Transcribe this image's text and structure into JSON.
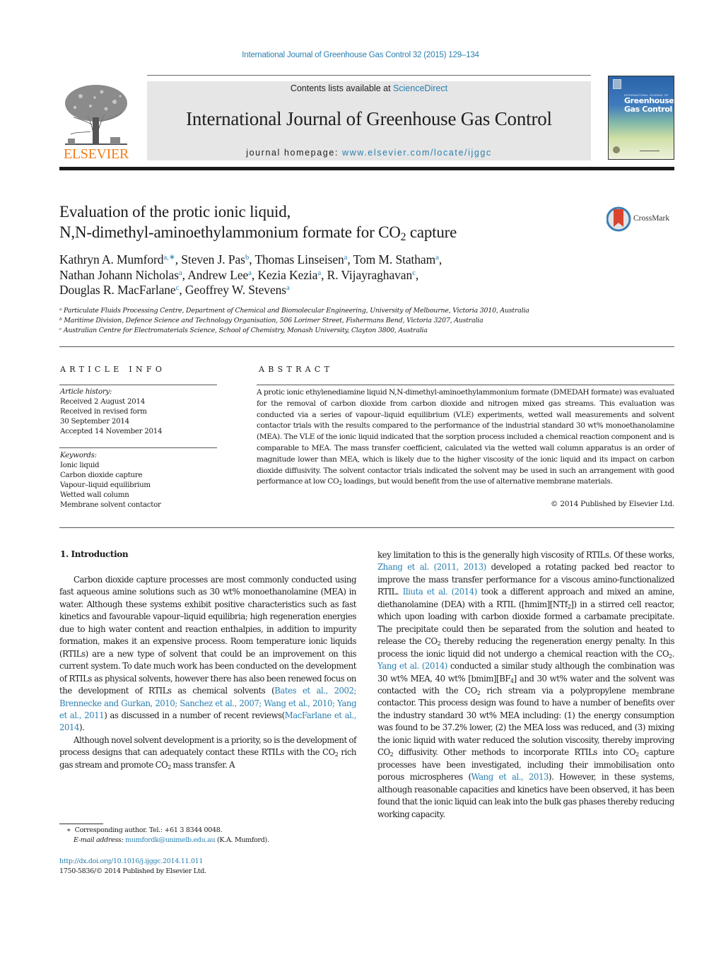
{
  "running_head": "International Journal of Greenhouse Gas Control 32 (2015) 129–134",
  "banner": {
    "contents_prefix": "Contents lists available at ",
    "contents_link": "ScienceDirect",
    "journal_title": "International Journal of Greenhouse Gas Control",
    "homepage_prefix": "journal homepage: ",
    "homepage_link": "www.elsevier.com/locate/ijggc"
  },
  "publisher_logo": {
    "wordmark": "ELSEVIER",
    "color": "#f07d1a"
  },
  "cover": {
    "supertitle": "INTERNATIONAL JOURNAL OF",
    "title_line1": "Greenhouse",
    "title_line2": "Gas Control"
  },
  "crossmark": {
    "label": "CrossMark"
  },
  "article": {
    "title_line1": "Evaluation of the protic ionic liquid,",
    "title_line2_pre": "N,N-dimethyl-aminoethylammonium formate for CO",
    "title_line2_sub": "2",
    "title_line2_post": " capture",
    "authors": [
      {
        "name": "Kathryn A. Mumford",
        "aff": "a,∗",
        "sep": ", "
      },
      {
        "name": "Steven J. Pas",
        "aff": "b",
        "sep": ", "
      },
      {
        "name": "Thomas Linseisen",
        "aff": "a",
        "sep": ", "
      },
      {
        "name": "Tom M. Statham",
        "aff": "a",
        "sep": ","
      },
      {
        "name": "Nathan Johann Nicholas",
        "aff": "a",
        "sep": ", "
      },
      {
        "name": "Andrew Lee",
        "aff": "a",
        "sep": ", "
      },
      {
        "name": "Kezia Kezia",
        "aff": "a",
        "sep": ", "
      },
      {
        "name": "R. Vijayraghavan",
        "aff": "c",
        "sep": ","
      },
      {
        "name": "Douglas R. MacFarlane",
        "aff": "c",
        "sep": ", "
      },
      {
        "name": "Geoffrey W. Stevens",
        "aff": "a",
        "sep": ""
      }
    ],
    "affiliations": [
      {
        "key": "a",
        "text": "Particulate Fluids Processing Centre, Department of Chemical and Biomolecular Engineering, University of Melbourne, Victoria 3010, Australia"
      },
      {
        "key": "b",
        "text": "Maritime Division, Defence Science and Technology Organisation, 506 Lorimer Street, Fishermans Bend, Victoria 3207, Australia"
      },
      {
        "key": "c",
        "text": "Australian Centre for Electromaterials Science, School of Chemistry, Monash University, Clayton 3800, Australia"
      }
    ]
  },
  "article_info": {
    "heading": "ARTICLE INFO",
    "history_label": "Article history:",
    "history": [
      "Received 2 August 2014",
      "Received in revised form",
      "30 September 2014",
      "Accepted 14 November 2014"
    ],
    "keywords_label": "Keywords:",
    "keywords": [
      "Ionic liquid",
      "Carbon dioxide capture",
      "Vapour–liquid equilibrium",
      "Wetted wall column",
      "Membrane solvent contactor"
    ]
  },
  "abstract": {
    "heading": "ABSTRACT",
    "text_main": "A protic ionic ethylenediamine liquid N,N-dimethyl-aminoethylammonium formate (DMEDAH formate) was evaluated for the removal of carbon dioxide from carbon dioxide and nitrogen mixed gas streams. This evaluation was conducted via a series of vapour–liquid equilibrium (VLE) experiments, wetted wall measurements and solvent contactor trials with the results compared to the performance of the industrial standard 30 wt% monoethanolamine (MEA). The VLE of the ionic liquid indicated that the sorption process included a chemical reaction component and is comparable to MEA. The mass transfer coefficient, calculated via the wetted wall column apparatus is an order of magnitude lower than MEA, which is likely due to the higher viscosity of the ionic liquid and its impact on carbon dioxide diffusivity. The solvent contactor trials indicated the solvent may be used in such an arrangement with good performance at low CO",
    "text_sub": "2",
    "text_end": " loadings, but would benefit from the use of alternative membrane materials.",
    "copyright": "© 2014 Published by Elsevier Ltd."
  },
  "introduction": {
    "heading": "1.  Introduction",
    "p1": [
      {
        "t": "Carbon dioxide capture processes are most commonly conducted using fast aqueous amine solutions such as 30 wt% monoethanolamine (MEA) in water. Although these systems exhibit positive characteristics such as fast kinetics and favourable vapour–liquid equilibria; high regeneration energies due to high water content and reaction enthalpies, in addition to impurity formation, makes it an expensive process. Room temperature ionic liquids (RTILs) are a new type of solvent that could be an improvement on this current system. To date much work has been conducted on the development of RTILs as physical solvents, however there has also been renewed focus on the development of RTILs as chemical solvents ("
      },
      {
        "link": "Bates et al., 2002; Brennecke and Gurkan, 2010; Sanchez et al., 2007; Wang et al., 2010; Yang et al., 2011"
      },
      {
        "t": ") as discussed in a number of recent reviews("
      },
      {
        "link": "MacFarlane et al., 2014"
      },
      {
        "t": ")."
      }
    ],
    "p2": [
      {
        "t": "Although novel solvent development is a priority, so is the development of process designs that can adequately contact these RTILs with the CO"
      },
      {
        "sub": "2"
      },
      {
        "t": " rich gas stream and promote CO"
      },
      {
        "sub": "2"
      },
      {
        "t": " mass transfer. A key limitation to this is the generally high viscosity of RTILs. Of these works, "
      },
      {
        "link": "Zhang et al. (2011, 2013)"
      },
      {
        "t": " developed a rotating packed bed reactor to improve the mass transfer performance for a viscous amino-functionalized RTIL. "
      },
      {
        "link": "Iliuta et al. (2014)"
      },
      {
        "t": " took a different approach and mixed an amine, diethanolamine (DEA) with a RTIL ([hmim][NTf"
      },
      {
        "sub": "2"
      },
      {
        "t": "]) in a stirred cell reactor, which upon loading with carbon dioxide formed a carbamate precipitate. The precipitate could then be separated from the solution and heated to release the CO"
      },
      {
        "sub": "2"
      },
      {
        "t": " thereby reducing the regeneration energy penalty. In this process the ionic liquid did not undergo a chemical reaction with the CO"
      },
      {
        "sub": "2"
      },
      {
        "t": ". "
      },
      {
        "link": "Yang et al. (2014)"
      },
      {
        "t": " conducted a similar study although the combination was 30 wt% MEA, 40 wt% [bmim][BF"
      },
      {
        "sub": "4"
      },
      {
        "t": "] and 30 wt% water and the solvent was contacted with the CO"
      },
      {
        "sub": "2"
      },
      {
        "t": " rich stream via a polypropylene membrane contactor. This process design was found to have a number of benefits over the industry standard 30 wt% MEA including: (1) the energy consumption was found to be 37.2% lower, (2) the MEA loss was reduced, and (3) mixing the ionic liquid with water reduced the solution viscosity, thereby improving CO"
      },
      {
        "sub": "2"
      },
      {
        "t": " diffusivity. Other methods to incorporate RTILs into CO"
      },
      {
        "sub": "2"
      },
      {
        "t": " capture processes have been investigated, including their immobilisation onto porous microspheres ("
      },
      {
        "link": "Wang et al., 2013"
      },
      {
        "t": "). However, in these systems, although reasonable capacities and kinetics have been observed, it has been found that the ionic liquid can leak into the bulk gas phases thereby reducing working capacity."
      }
    ]
  },
  "footnotes": {
    "star": "∗",
    "corresponding": "Corresponding author. Tel.: +61 3 8344 0048.",
    "email_label": "E-mail address: ",
    "email": "mumfordk@unimelb.edu.au",
    "email_suffix": " (K.A. Mumford).",
    "doi": "http://dx.doi.org/10.1016/j.ijggc.2014.11.011",
    "issn_line": "1750-5836/© 2014 Published by Elsevier Ltd."
  },
  "colors": {
    "link": "#2a7fb0",
    "elsevier_orange": "#f07d1a",
    "banner_gray": "#e6e6e6"
  }
}
